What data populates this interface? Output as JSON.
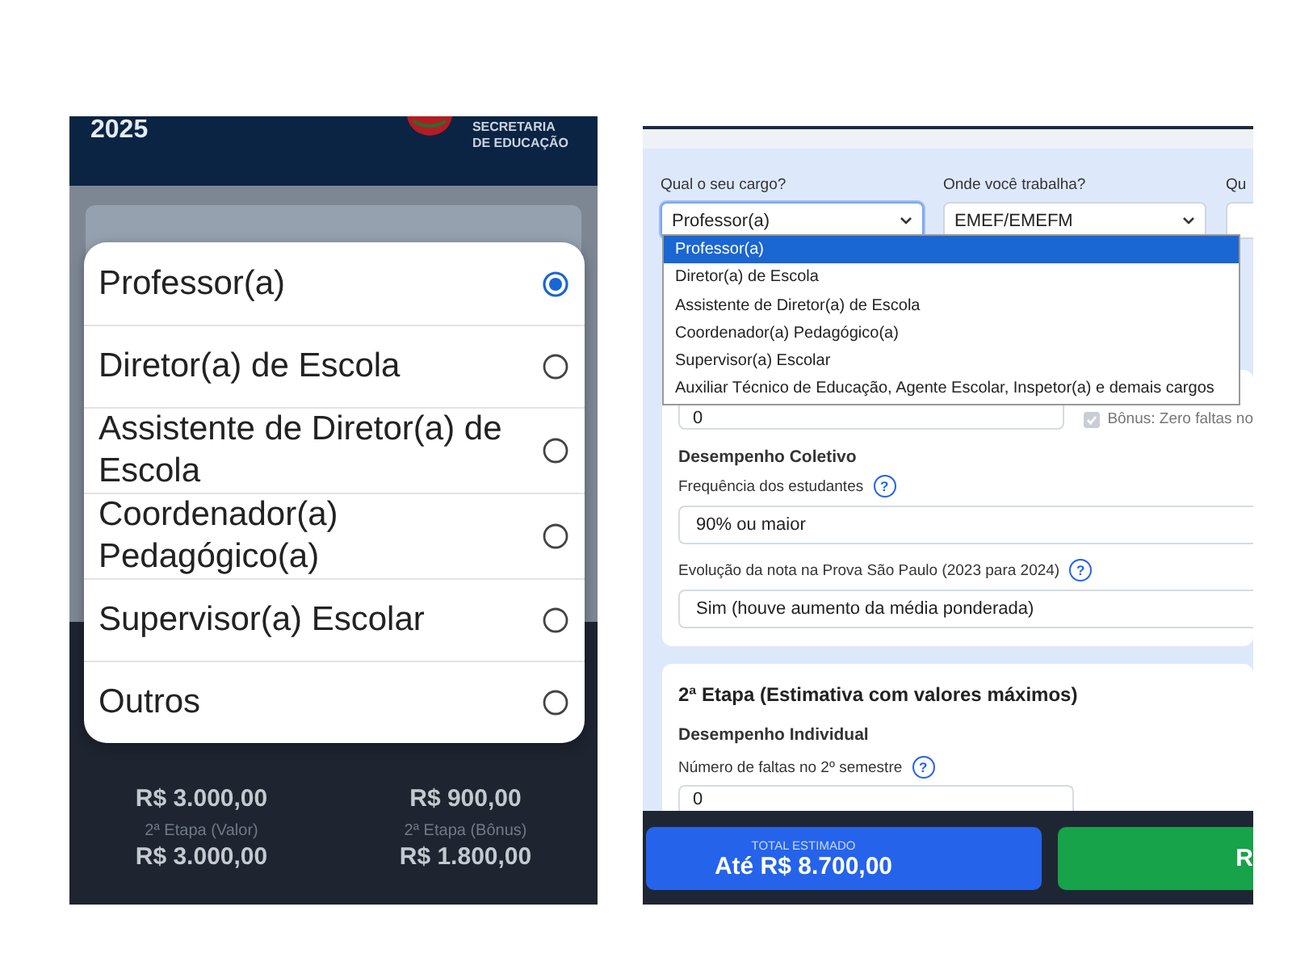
{
  "mobile": {
    "header": {
      "year": "2025",
      "org_lines": [
        "SECRETARIA",
        "DE EDUCAÇÃO"
      ]
    },
    "options": [
      {
        "label": "Professor(a)",
        "selected": true
      },
      {
        "label": "Diretor(a) de Escola",
        "selected": false
      },
      {
        "label": "Assistente de Diretor(a) de Escola",
        "selected": false
      },
      {
        "label": "Coordenador(a) Pedagógico(a)",
        "selected": false
      },
      {
        "label": "Supervisor(a) Escolar",
        "selected": false
      },
      {
        "label": "Outros",
        "selected": false
      }
    ],
    "summary": [
      {
        "value": "R$ 3.000,00"
      },
      {
        "value": "R$ 900,00"
      },
      {
        "label": "2ª Etapa (Valor)",
        "value": "R$ 3.000,00"
      },
      {
        "label": "2ª Etapa (Bônus)",
        "value": "R$ 1.800,00"
      }
    ]
  },
  "web": {
    "fields": [
      {
        "label": "Qual o seu cargo?",
        "value": "Professor(a)",
        "focused": true
      },
      {
        "label": "Onde você trabalha?",
        "value": "EMEF/EMEFM",
        "focused": false
      },
      {
        "label": "Qu",
        "focused": false
      }
    ],
    "cargo_dropdown": [
      {
        "label": "Professor(a)",
        "selected": true
      },
      {
        "label": "Diretor(a) de Escola",
        "selected": false
      },
      {
        "label": "Assistente de Diretor(a) de Escola",
        "selected": false
      },
      {
        "label": "Coordenador(a) Pedagógico(a)",
        "selected": false
      },
      {
        "label": "Supervisor(a) Escolar",
        "selected": false
      },
      {
        "label": "Auxiliar Técnico de Educação, Agente Escolar, Inspetor(a) e demais cargos",
        "selected": false
      }
    ],
    "absences_input": {
      "value": "0"
    },
    "bonus_checkbox": {
      "label": "Bônus: Zero faltas no",
      "checked": true,
      "disabled": true
    },
    "collective": {
      "heading": "Desempenho Coletivo",
      "fields": [
        {
          "label": "Frequência dos estudantes",
          "help": "?",
          "value": "90% ou maior"
        },
        {
          "label": "Evolução da nota na Prova São Paulo (2023 para 2024)",
          "help": "?",
          "value": "Sim (houve aumento da média ponderada)"
        }
      ]
    },
    "stage2": {
      "title": "2ª Etapa (Estimativa com valores máximos)",
      "heading": "Desempenho Individual",
      "field_label": "Número de faltas no 2º semestre",
      "help": "?",
      "value": "0"
    },
    "footer": {
      "total_label": "TOTAL ESTIMADO",
      "total_value": "Até R$ 8.700,00",
      "action": "R"
    }
  }
}
